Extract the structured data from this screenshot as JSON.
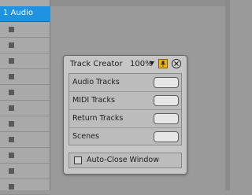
{
  "track": {
    "name": "1 Audio",
    "accent": "#1f93e0",
    "slot_icon": "stop-square-icon"
  },
  "dialog": {
    "title": "Track Creator",
    "zoom": "100%",
    "zoom_icon": "triangle-down-icon",
    "pin_icon": "pin-icon",
    "pin_color": "#f0b400",
    "close_icon": "close-icon",
    "rows": [
      {
        "label": "Audio Tracks",
        "value": ""
      },
      {
        "label": "MIDI Tracks",
        "value": ""
      },
      {
        "label": "Return Tracks",
        "value": ""
      },
      {
        "label": "Scenes",
        "value": ""
      }
    ],
    "auto_close": {
      "label": "Auto-Close Window",
      "checked": false
    }
  }
}
